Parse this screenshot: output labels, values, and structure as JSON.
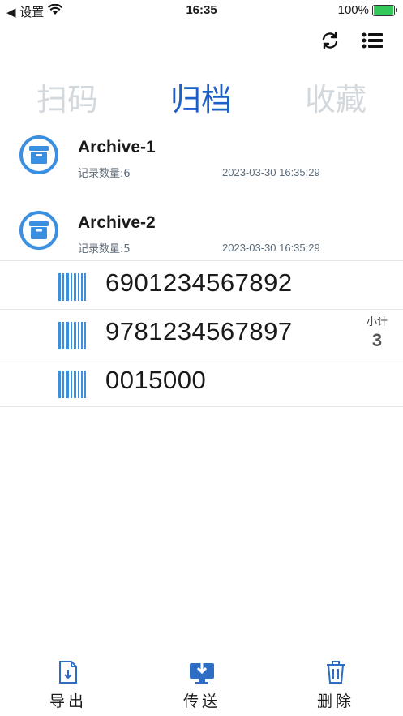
{
  "status_bar": {
    "back_label": "◀ 设置",
    "time": "16:35",
    "battery": "100%"
  },
  "toolbar": {
    "refresh_icon": "refresh-icon",
    "list_icon": "list-icon"
  },
  "tabs": [
    {
      "label": "扫码",
      "active": false
    },
    {
      "label": "归档",
      "active": true
    },
    {
      "label": "收藏",
      "active": false
    }
  ],
  "archives": [
    {
      "title": "Archive-1",
      "count_label": "记录数量:6",
      "date": "2023-03-30 16:35:29"
    },
    {
      "title": "Archive-2",
      "count_label": "记录数量:5",
      "date": "2023-03-30 16:35:29"
    }
  ],
  "records": [
    {
      "code": "6901234567892"
    },
    {
      "code": "9781234567897"
    },
    {
      "code": "0015000"
    }
  ],
  "subtotal": {
    "label": "小计",
    "value": "3"
  },
  "bottom_bar": {
    "export_label": "导出",
    "send_label": "传送",
    "delete_label": "删除"
  },
  "colors": {
    "accent": "#1c5fc7",
    "icon_blue": "#3b8fe0",
    "inactive_tab": "#d3d8dd",
    "battery_green": "#34c759"
  }
}
